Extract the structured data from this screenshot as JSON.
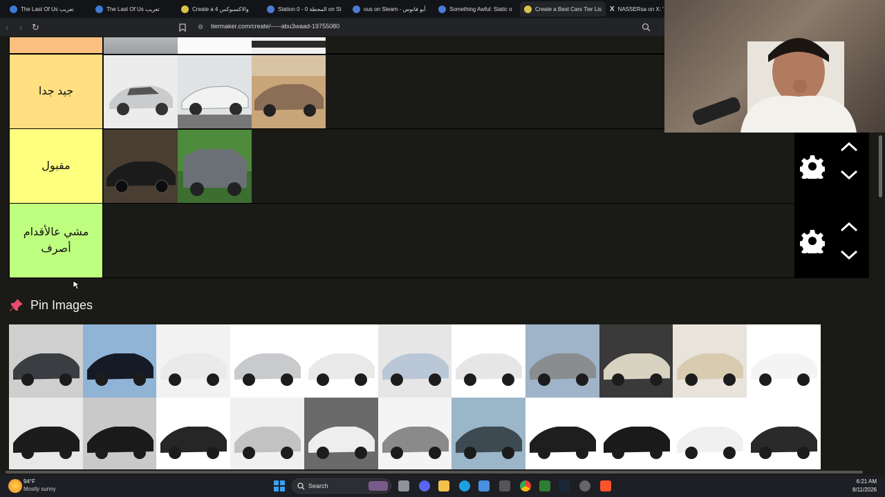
{
  "browser": {
    "tabs": [
      {
        "label": "The Last Of Us تعريب",
        "color": "#3a7bd5"
      },
      {
        "label": "The Last Of Us تعريب",
        "color": "#3a7bd5"
      },
      {
        "label": "Create a والاكسبوكس 4",
        "color": "#d8c24a"
      },
      {
        "label": "Station 0 - 0 المحطة on St",
        "color": "#4b7bd8"
      },
      {
        "label": "ous on Steam - أبو فانوس",
        "color": "#4b7bd8"
      },
      {
        "label": "Something Awful: Static o",
        "color": "#4b7bd8"
      },
      {
        "label": "Create a Best Cars Tier Lis",
        "color": "#d8c24a"
      },
      {
        "label": "NASSERsa on X: \"@",
        "color": "#ffffff"
      }
    ],
    "url": "tiermaker.com/create/-----abu3waad-19755080"
  },
  "tiers": [
    {
      "label": "",
      "color": "#fbbf7f",
      "cars": 3,
      "partial": true
    },
    {
      "label": "جيد جدا",
      "color": "#ffdf80",
      "cars": 3
    },
    {
      "label": "مقبول",
      "color": "#ffff7f",
      "cars": 2
    },
    {
      "label": "مشي عالأقدام أصرف",
      "color": "#bfff7f",
      "cars": 0
    }
  ],
  "pin_images": {
    "title": "Pin Images",
    "count": 22
  },
  "taskbar": {
    "weather_temp": "94°F",
    "weather_desc": "Mostly sunny",
    "search_placeholder": "Search",
    "time": "6:21 AM",
    "date": "8/11/2026"
  },
  "icons": [
    "back-icon",
    "forward-icon",
    "reload-icon",
    "bookmark-icon",
    "site-info-icon",
    "zoom-icon",
    "gear-icon",
    "chevron-up-icon",
    "chevron-down-icon",
    "pin-icon",
    "windows-start-icon",
    "search-icon"
  ]
}
